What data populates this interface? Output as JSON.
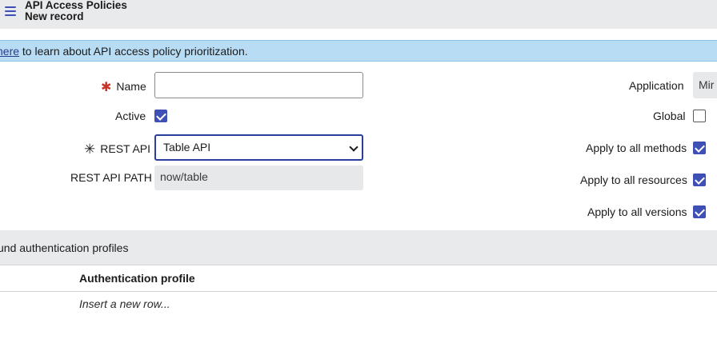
{
  "header": {
    "title": "API Access Policies",
    "subtitle": "New record",
    "menu_icon": "hamburger-menu-icon"
  },
  "info_banner": {
    "link_text": "here",
    "text": " to learn about API access policy prioritization."
  },
  "form": {
    "name": {
      "label": "Name",
      "value": "",
      "required": true
    },
    "active": {
      "label": "Active",
      "checked": true
    },
    "rest_api": {
      "label": "REST API",
      "value": "Table API",
      "required": true
    },
    "rest_api_path": {
      "label": "REST API PATH",
      "value": "now/table"
    },
    "application": {
      "label": "Application",
      "value": "Mir"
    },
    "global": {
      "label": "Global",
      "checked": false
    },
    "apply_all_methods": {
      "label": "Apply to all methods",
      "checked": true
    },
    "apply_all_resources": {
      "label": "Apply to all resources",
      "checked": true
    },
    "apply_all_versions": {
      "label": "Apply to all versions",
      "checked": true
    }
  },
  "related_list": {
    "title": "und authentication profiles",
    "column_header": "Authentication profile",
    "insert_row": "Insert a new row..."
  },
  "colors": {
    "accent": "#3e4fb5",
    "banner": "#b8dcf3",
    "required": "#c8332a",
    "header_bg": "#e9eaec"
  }
}
